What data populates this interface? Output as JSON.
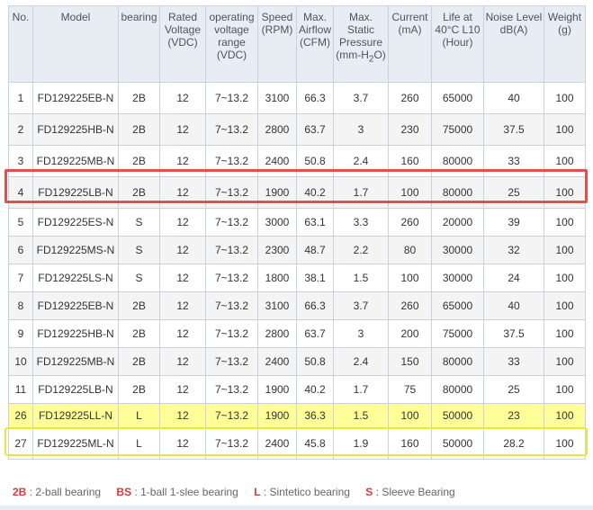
{
  "table": {
    "headers": {
      "no": "No.",
      "model": "Model",
      "bearing": "bearing",
      "rated_voltage": "Rated Voltage (VDC)",
      "operating_voltage": "operating voltage range (VDC)",
      "speed": "Speed (RPM)",
      "airflow": "Max. Airflow (CFM)",
      "pressure_prefix": "Max. Static Pressure (mm-H",
      "pressure_sub": "2",
      "pressure_suffix": "O)",
      "current": "Current (mA)",
      "life": "Life at 40°C L10 (Hour)",
      "noise": "Noise Level dB(A)",
      "weight": "Weight (g)"
    },
    "rows": [
      {
        "no": "1",
        "model": "FD129225EB-N",
        "bearing": "2B",
        "rated": "12",
        "range": "7~13.2",
        "speed": "3100",
        "airflow": "66.3",
        "pressure": "3.7",
        "current": "260",
        "life": "65000",
        "noise": "40",
        "weight": "100"
      },
      {
        "no": "2",
        "model": "FD129225HB-N",
        "bearing": "2B",
        "rated": "12",
        "range": "7~13.2",
        "speed": "2800",
        "airflow": "63.7",
        "pressure": "3",
        "current": "230",
        "life": "75000",
        "noise": "37.5",
        "weight": "100"
      },
      {
        "no": "3",
        "model": "FD129225MB-N",
        "bearing": "2B",
        "rated": "12",
        "range": "7~13.2",
        "speed": "2400",
        "airflow": "50.8",
        "pressure": "2.4",
        "current": "160",
        "life": "80000",
        "noise": "33",
        "weight": "100"
      },
      {
        "no": "4",
        "model": "FD129225LB-N",
        "bearing": "2B",
        "rated": "12",
        "range": "7~13.2",
        "speed": "1900",
        "airflow": "40.2",
        "pressure": "1.7",
        "current": "100",
        "life": "80000",
        "noise": "25",
        "weight": "100"
      },
      {
        "no": "5",
        "model": "FD129225ES-N",
        "bearing": "S",
        "rated": "12",
        "range": "7~13.2",
        "speed": "3000",
        "airflow": "63.1",
        "pressure": "3.3",
        "current": "260",
        "life": "20000",
        "noise": "39",
        "weight": "100"
      },
      {
        "no": "6",
        "model": "FD129225MS-N",
        "bearing": "S",
        "rated": "12",
        "range": "7~13.2",
        "speed": "2300",
        "airflow": "48.7",
        "pressure": "2.2",
        "current": "80",
        "life": "30000",
        "noise": "32",
        "weight": "100"
      },
      {
        "no": "7",
        "model": "FD129225LS-N",
        "bearing": "S",
        "rated": "12",
        "range": "7~13.2",
        "speed": "1800",
        "airflow": "38.1",
        "pressure": "1.5",
        "current": "100",
        "life": "30000",
        "noise": "24",
        "weight": "100"
      },
      {
        "no": "8",
        "model": "FD129225EB-N",
        "bearing": "2B",
        "rated": "12",
        "range": "7~13.2",
        "speed": "3100",
        "airflow": "66.3",
        "pressure": "3.7",
        "current": "260",
        "life": "65000",
        "noise": "40",
        "weight": "100"
      },
      {
        "no": "9",
        "model": "FD129225HB-N",
        "bearing": "2B",
        "rated": "12",
        "range": "7~13.2",
        "speed": "2800",
        "airflow": "63.7",
        "pressure": "3",
        "current": "200",
        "life": "75000",
        "noise": "37.5",
        "weight": "100"
      },
      {
        "no": "10",
        "model": "FD129225MB-N",
        "bearing": "2B",
        "rated": "12",
        "range": "7~13.2",
        "speed": "2400",
        "airflow": "50.8",
        "pressure": "2.4",
        "current": "150",
        "life": "80000",
        "noise": "33",
        "weight": "100"
      },
      {
        "no": "11",
        "model": "FD129225LB-N",
        "bearing": "2B",
        "rated": "12",
        "range": "7~13.2",
        "speed": "1900",
        "airflow": "40.2",
        "pressure": "1.7",
        "current": "75",
        "life": "80000",
        "noise": "25",
        "weight": "100"
      },
      {
        "no": "26",
        "model": "FD129225LL-N",
        "bearing": "L",
        "rated": "12",
        "range": "7~13.2",
        "speed": "1900",
        "airflow": "36.3",
        "pressure": "1.5",
        "current": "100",
        "life": "50000",
        "noise": "23",
        "weight": "100"
      },
      {
        "no": "27",
        "model": "FD129225ML-N",
        "bearing": "L",
        "rated": "12",
        "range": "7~13.2",
        "speed": "2400",
        "airflow": "45.8",
        "pressure": "1.9",
        "current": "160",
        "life": "50000",
        "noise": "28.2",
        "weight": "100"
      }
    ]
  },
  "legend": [
    {
      "code": "2B",
      "sep": " : ",
      "text": "2-ball bearing"
    },
    {
      "code": "BS",
      "sep": " : ",
      "text": "1-ball 1-slee bearing"
    },
    {
      "code": "L",
      "sep": " : ",
      "text": "Sintetico bearing"
    },
    {
      "code": "S",
      "sep": " : ",
      "text": "Sleeve Bearing"
    }
  ],
  "colors": {
    "header_bg": "#e8edf3",
    "border": "#c9d2dc",
    "red_highlight": "#e05050",
    "yellow_highlight": "#ffff99",
    "legend_code": "#d63a3a"
  }
}
